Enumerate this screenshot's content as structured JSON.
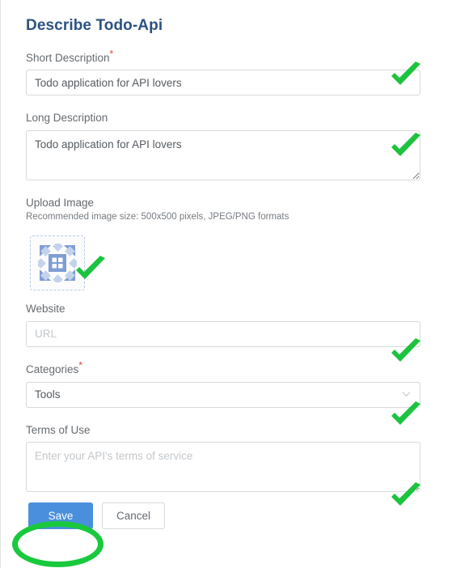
{
  "header": {
    "title": "Describe Todo-Api"
  },
  "fields": {
    "short_description": {
      "label": "Short Description",
      "required_marker": "*",
      "value": "Todo application for API lovers",
      "placeholder": ""
    },
    "long_description": {
      "label": "Long Description",
      "required_marker": "",
      "value": "Todo application for API lovers",
      "placeholder": ""
    },
    "upload_image": {
      "label": "Upload Image",
      "hint": "Recommended image size: 500x500 pixels, JPEG/PNG formats"
    },
    "website": {
      "label": "Website",
      "required_marker": "",
      "value": "",
      "placeholder": "URL"
    },
    "categories": {
      "label": "Categories",
      "required_marker": "*",
      "value": "Tools",
      "options": [
        "Tools"
      ]
    },
    "terms_of_use": {
      "label": "Terms of Use",
      "required_marker": "",
      "value": "",
      "placeholder": "Enter your API's terms of service"
    }
  },
  "buttons": {
    "save_label": "Save",
    "cancel_label": "Cancel"
  },
  "icons": {
    "check": "green-check-icon",
    "chevron": "chevron-down-icon",
    "thumbnail": "identicon-thumbnail-icon"
  },
  "colors": {
    "title": "#2c5282",
    "save_button": "#4a8fdd",
    "check_green": "#1cc33f",
    "annotation_green": "#18c93c",
    "required_red": "#e04141",
    "label_gray": "#666b70",
    "input_border": "#d6d9dc",
    "identicon_blue": "#7e9ed4",
    "identicon_light": "#c4d3ec"
  }
}
